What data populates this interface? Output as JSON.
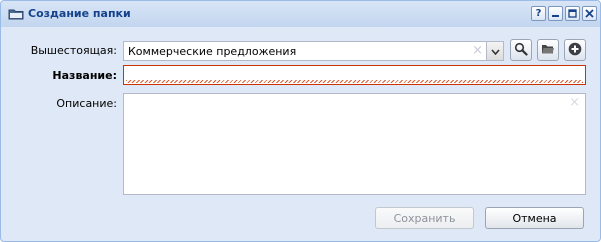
{
  "window": {
    "title": "Создание папки",
    "help_label": "?"
  },
  "form": {
    "parent": {
      "label": "Вышестоящая:",
      "value": "Коммерческие предложения"
    },
    "name": {
      "label": "Название:",
      "value": ""
    },
    "description": {
      "label": "Описание:",
      "value": ""
    }
  },
  "buttons": {
    "save": "Сохранить",
    "cancel": "Отмена"
  },
  "icons": {
    "title": "folder-icon",
    "search": "search-icon",
    "browse": "open-folder-icon",
    "add": "plus-icon"
  },
  "colors": {
    "title_text": "#15428b",
    "panel_bg": "#dfe8f6",
    "invalid_border": "#cc3300"
  }
}
